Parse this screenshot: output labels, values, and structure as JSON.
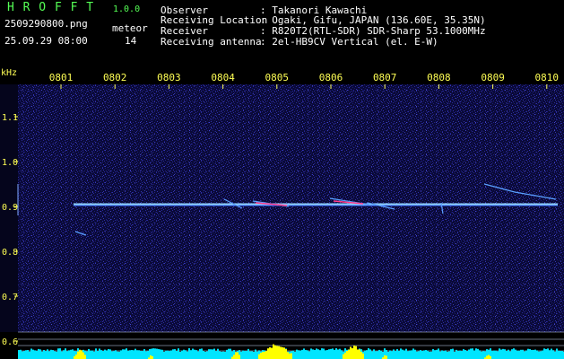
{
  "header": {
    "app_title": "H R O F F T",
    "version": "1.0.0",
    "filename": "2509290800.png",
    "datetime": "25.09.29 08:00",
    "meteor_label": "meteor",
    "meteor_count": "14",
    "info": [
      {
        "label": "Observer",
        "value": ": Takanori Kawachi"
      },
      {
        "label": "Receiving Location",
        "value": ": Ogaki, Gifu, JAPAN (136.60E, 35.35N)"
      },
      {
        "label": "Receiver",
        "value": ": R820T2(RTL-SDR) SDR-Sharp 53.1000MHz"
      },
      {
        "label": "Receiving antenna",
        "value": ": 2el-HB9CV Vertical (el. E-W)"
      }
    ]
  },
  "chart_data": {
    "type": "heatmap",
    "ylabel": "kHz",
    "y_ticks": [
      "1.1",
      "1.0",
      "0.9",
      "0.8",
      "0.7",
      "0.6"
    ],
    "x_ticks": [
      "0801",
      "0802",
      "0803",
      "0804",
      "0805",
      "0806",
      "0807",
      "0808",
      "0809",
      "0810"
    ],
    "carrier_khz": 0.905,
    "meteor_count": 14
  },
  "colors": {
    "background": "#000000",
    "header_green": "#55ff55",
    "header_white": "#ffffff",
    "tick_yellow": "#ffff55",
    "noise_base": "#0a0a3a",
    "carrier": "#8fd0ff",
    "level_cyan": "#00e5ff",
    "level_yellow": "#ffff00"
  }
}
